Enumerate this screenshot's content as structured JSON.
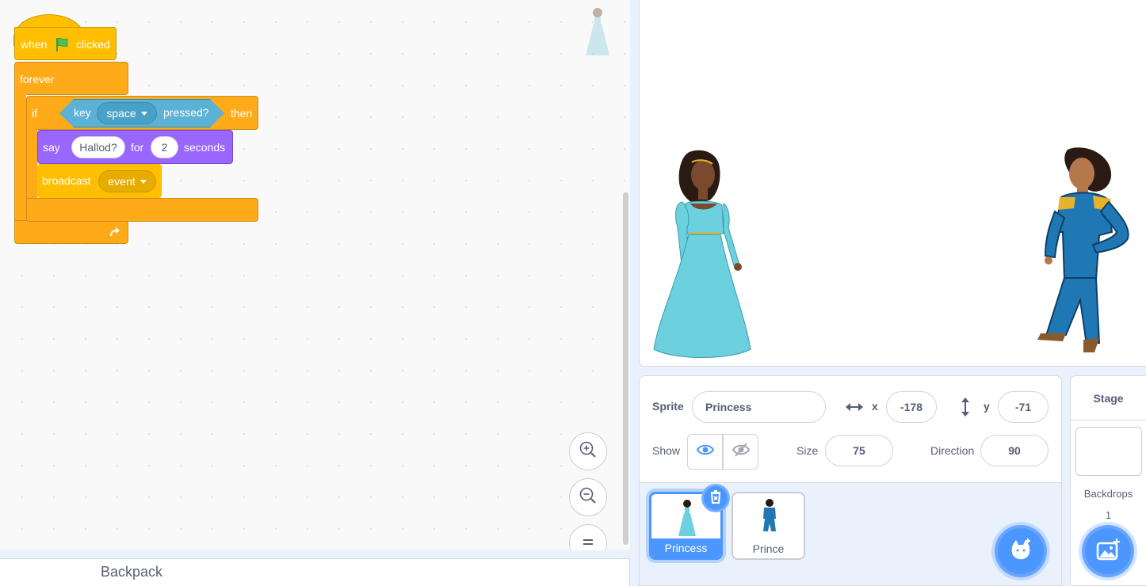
{
  "script": {
    "hat": {
      "when": "when",
      "clicked": "clicked"
    },
    "forever": "forever",
    "if_block": {
      "if": "if",
      "then": "then"
    },
    "key_pressed": {
      "key": "key",
      "key_value": "space",
      "pressed": "pressed?"
    },
    "say_block": {
      "say": "say",
      "message": "Hallod?",
      "for": "for",
      "secs": "2",
      "seconds": "seconds"
    },
    "broadcast_block": {
      "broadcast": "broadcast",
      "message": "event"
    }
  },
  "backpack": {
    "label": "Backpack"
  },
  "sprite_info": {
    "sprite_label": "Sprite",
    "sprite_name": "Princess",
    "x_label": "x",
    "x_value": "-178",
    "y_label": "y",
    "y_value": "-71",
    "show_label": "Show",
    "size_label": "Size",
    "size_value": "75",
    "direction_label": "Direction",
    "direction_value": "90"
  },
  "sprites": [
    {
      "name": "Princess",
      "selected": true
    },
    {
      "name": "Prince",
      "selected": false
    }
  ],
  "stage_pane": {
    "title": "Stage",
    "backdrops_label": "Backdrops",
    "backdrops_count": "1"
  },
  "colors": {
    "events": "#ffbf00",
    "control": "#ffab19",
    "looks": "#9966ff",
    "sensing": "#5cb1d6",
    "accent": "#4c97ff",
    "text": "#575e75"
  }
}
